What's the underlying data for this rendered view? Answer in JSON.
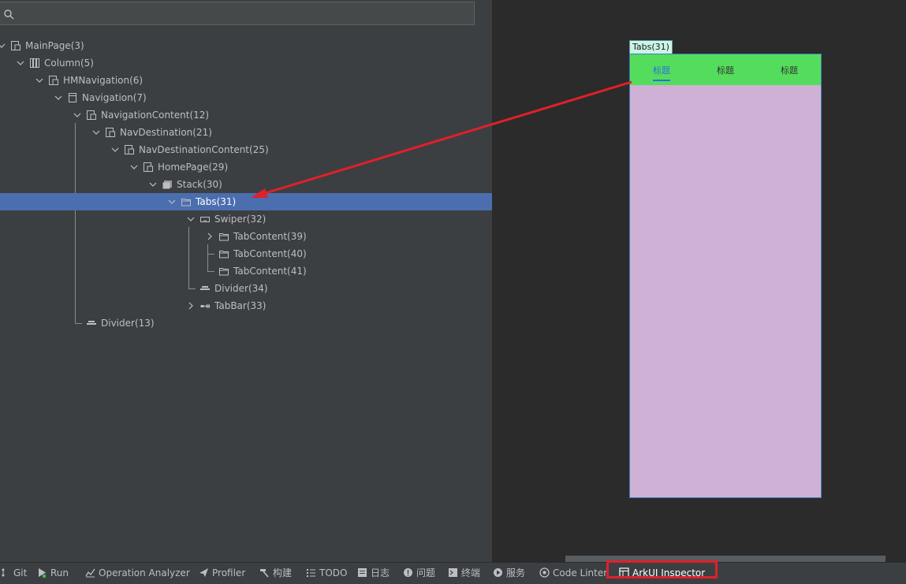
{
  "search": {
    "placeholder": ""
  },
  "tree": [
    {
      "label": "MainPage(3)",
      "icon": "page-icon",
      "expanded": true
    },
    {
      "label": "Column(5)",
      "icon": "column-icon",
      "expanded": true
    },
    {
      "label": "HMNavigation(6)",
      "icon": "page-icon",
      "expanded": true
    },
    {
      "label": "Navigation(7)",
      "icon": "navigation-icon",
      "expanded": true
    },
    {
      "label": "NavigationContent(12)",
      "icon": "page-icon",
      "expanded": true
    },
    {
      "label": "NavDestination(21)",
      "icon": "page-icon",
      "expanded": true
    },
    {
      "label": "NavDestinationContent(25)",
      "icon": "page-icon",
      "expanded": true
    },
    {
      "label": "HomePage(29)",
      "icon": "page-icon",
      "expanded": true
    },
    {
      "label": "Stack(30)",
      "icon": "stack-icon",
      "expanded": true
    },
    {
      "label": "Tabs(31)",
      "icon": "folder-icon",
      "expanded": true,
      "selected": true
    },
    {
      "label": "Swiper(32)",
      "icon": "swiper-icon",
      "expanded": true
    },
    {
      "label": "TabContent(39)",
      "icon": "folder-icon",
      "expanded": false
    },
    {
      "label": "TabContent(40)",
      "icon": "folder-icon"
    },
    {
      "label": "TabContent(41)",
      "icon": "folder-icon"
    },
    {
      "label": "Divider(34)",
      "icon": "divider-icon"
    },
    {
      "label": "TabBar(33)",
      "icon": "tabbar-icon",
      "expanded": false
    },
    {
      "label": "Divider(13)",
      "icon": "divider-icon"
    }
  ],
  "preview": {
    "label": "Tabs(31)",
    "tabs": [
      "标题",
      "标题",
      "标题"
    ],
    "tabbar_color": "#54dd5c",
    "content_color": "#ceb1d5",
    "active_color": "#2a6fe0"
  },
  "statusbar": {
    "items": [
      {
        "label": "Git",
        "icon": "git-icon"
      },
      {
        "label": "Run",
        "icon": "run-icon"
      },
      {
        "label": "Operation Analyzer",
        "icon": "chart-icon"
      },
      {
        "label": "Profiler",
        "icon": "profiler-icon"
      },
      {
        "label": "构建",
        "icon": "hammer-icon"
      },
      {
        "label": "TODO",
        "icon": "list-icon"
      },
      {
        "label": "日志",
        "icon": "log-icon"
      },
      {
        "label": "问题",
        "icon": "problem-icon"
      },
      {
        "label": "终端",
        "icon": "terminal-icon"
      },
      {
        "label": "服务",
        "icon": "services-icon"
      },
      {
        "label": "Code Linter",
        "icon": "linter-icon"
      },
      {
        "label": "ArkUI Inspector",
        "icon": "inspector-icon",
        "highlighted": true
      }
    ]
  },
  "highlight_color": "#e0202a"
}
